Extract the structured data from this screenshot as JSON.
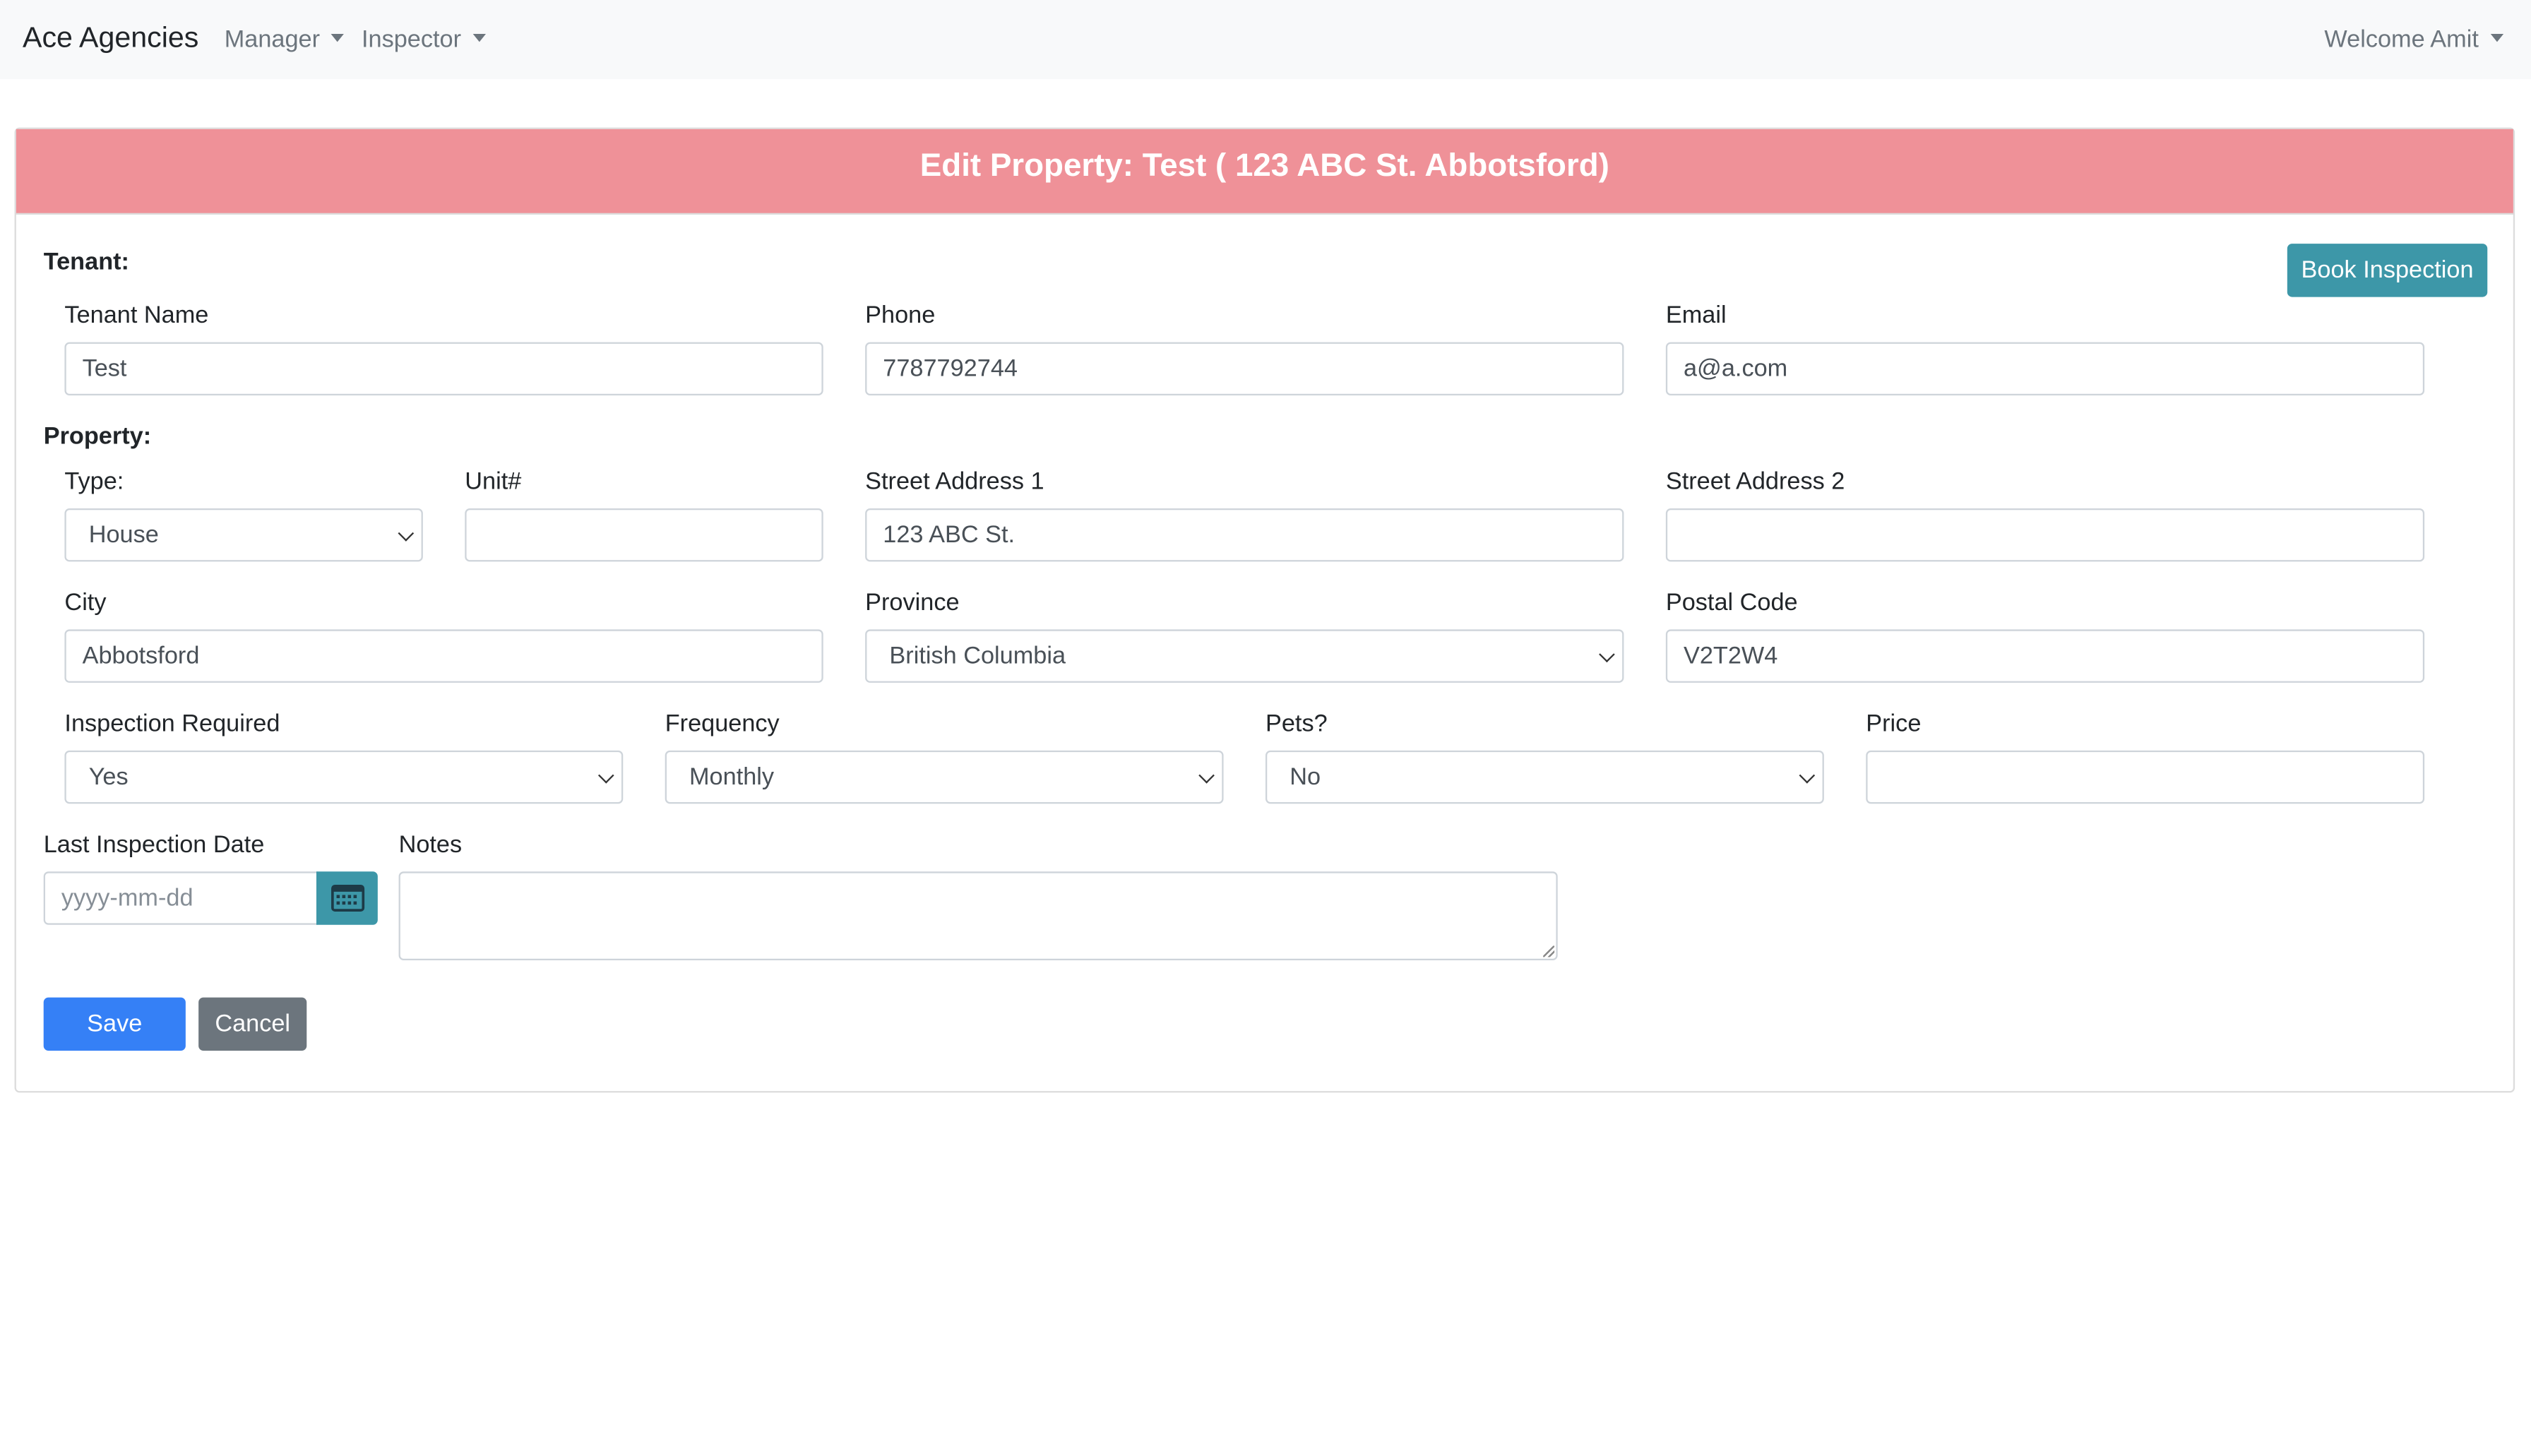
{
  "navbar": {
    "brand": "Ace Agencies",
    "menus": [
      {
        "label": "Manager"
      },
      {
        "label": "Inspector"
      }
    ],
    "user_menu": "Welcome Amit"
  },
  "card": {
    "title": "Edit Property: Test ( 123 ABC St. Abbotsford)",
    "book_inspection_label": "Book Inspection"
  },
  "tenant": {
    "section_label": "Tenant:",
    "name_label": "Tenant Name",
    "name_value": "Test",
    "phone_label": "Phone",
    "phone_value": "7787792744",
    "email_label": "Email",
    "email_value": "a@a.com"
  },
  "property": {
    "section_label": "Property:",
    "type_label": "Type:",
    "type_value": "House",
    "unit_label": "Unit#",
    "unit_value": "",
    "street1_label": "Street Address 1",
    "street1_value": "123 ABC St.",
    "street2_label": "Street Address 2",
    "street2_value": "",
    "city_label": "City",
    "city_value": "Abbotsford",
    "province_label": "Province",
    "province_value": "British Columbia",
    "postal_label": "Postal Code",
    "postal_value": "V2T2W4",
    "inspection_required_label": "Inspection Required",
    "inspection_required_value": "Yes",
    "frequency_label": "Frequency",
    "frequency_value": "Monthly",
    "pets_label": "Pets?",
    "pets_value": "No",
    "price_label": "Price",
    "price_value": "",
    "last_inspection_label": "Last Inspection Date",
    "last_inspection_placeholder": "yyyy-mm-dd",
    "notes_label": "Notes",
    "notes_value": ""
  },
  "actions": {
    "save_label": "Save",
    "cancel_label": "Cancel"
  },
  "colors": {
    "header_bg": "#ef9198",
    "info": "#3d97a8",
    "primary": "#3580f6",
    "secondary": "#6c757d"
  },
  "icons": {
    "calendar": "calendar-icon"
  }
}
